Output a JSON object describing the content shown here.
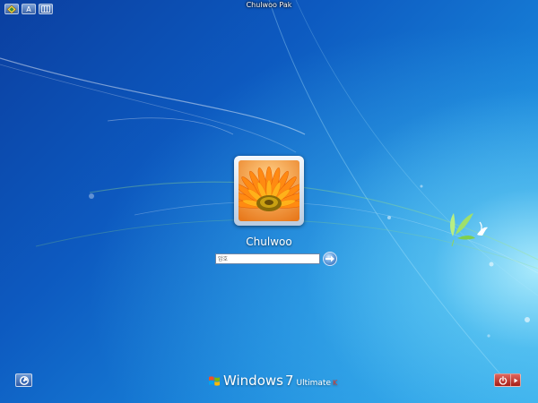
{
  "session": {
    "title": "Chulwoo Pak"
  },
  "ime_toolbar": [
    {
      "icon": "ime-mode-icon",
      "label": ""
    },
    {
      "icon": "font-a-icon",
      "label": "A"
    },
    {
      "icon": "keyboard-layout-icon",
      "label": ""
    }
  ],
  "user": {
    "name": "Chulwoo",
    "avatar": "orange-flower-picture"
  },
  "password": {
    "placeholder": "암호",
    "value": ""
  },
  "brand": {
    "product": "Windows",
    "version": "7",
    "edition": "Ultimate",
    "trademark": "K"
  },
  "buttons": {
    "ease_of_access": "ease-of-access-icon",
    "shutdown": "power-icon",
    "shutdown_options": "chevron-right-icon"
  },
  "colors": {
    "shutdown_red": "#c0302a",
    "background_blue": "#0d5ac0"
  }
}
